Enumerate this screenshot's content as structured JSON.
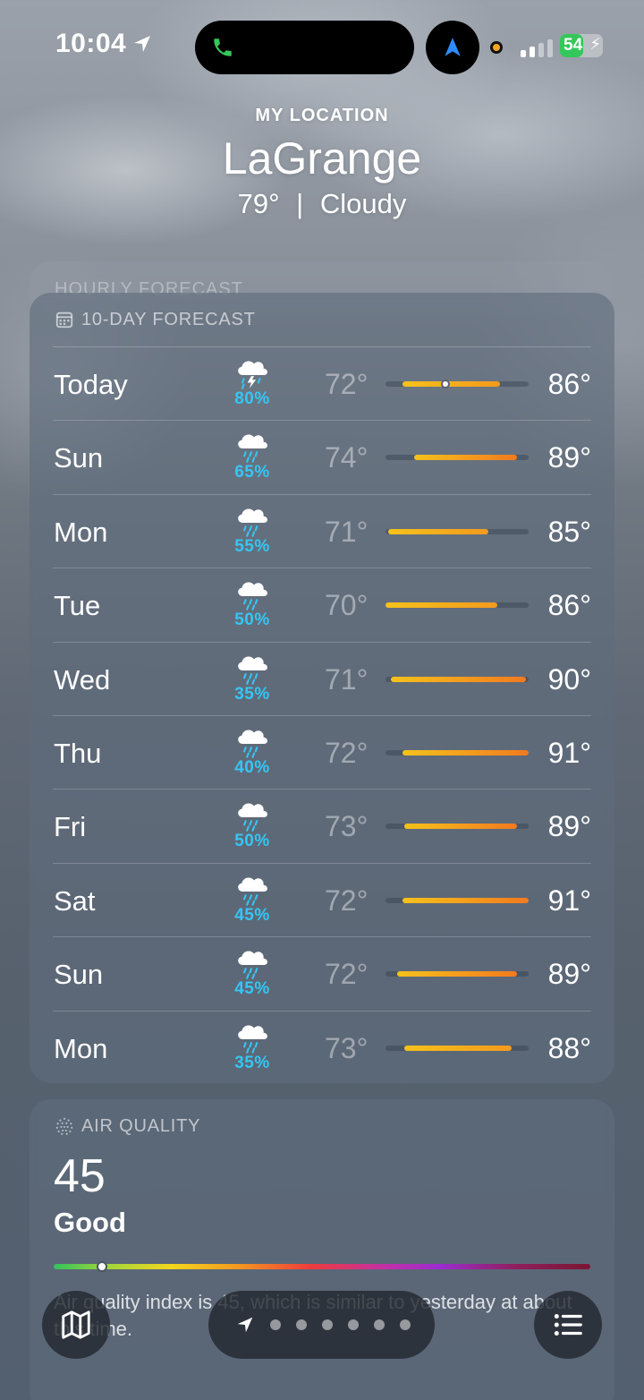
{
  "status_bar": {
    "time": "10:04",
    "battery": "54",
    "battery_level": 0.54
  },
  "header": {
    "location_label": "MY LOCATION",
    "city": "LaGrange",
    "temperature": "79°",
    "separator": "|",
    "condition": "Cloudy"
  },
  "hourly": {
    "title": "HOURLY FORECAST"
  },
  "forecast": {
    "title": "10-DAY FORECAST",
    "days": [
      {
        "day": "Today",
        "icon": "thunderstorm-rain-icon",
        "precip": "80%",
        "low": "72°",
        "high": "86°",
        "range_start": 0.12,
        "range_end": 0.8,
        "current": 0.42
      },
      {
        "day": "Sun",
        "icon": "rain-icon",
        "precip": "65%",
        "low": "74°",
        "high": "89°",
        "range_start": 0.2,
        "range_end": 0.92
      },
      {
        "day": "Mon",
        "icon": "rain-icon",
        "precip": "55%",
        "low": "71°",
        "high": "85°",
        "range_start": 0.02,
        "range_end": 0.72
      },
      {
        "day": "Tue",
        "icon": "rain-icon",
        "precip": "50%",
        "low": "70°",
        "high": "86°",
        "range_start": 0.0,
        "range_end": 0.78
      },
      {
        "day": "Wed",
        "icon": "rain-icon",
        "precip": "35%",
        "low": "71°",
        "high": "90°",
        "range_start": 0.04,
        "range_end": 0.98
      },
      {
        "day": "Thu",
        "icon": "rain-icon",
        "precip": "40%",
        "low": "72°",
        "high": "91°",
        "range_start": 0.12,
        "range_end": 1.0
      },
      {
        "day": "Fri",
        "icon": "rain-icon",
        "precip": "50%",
        "low": "73°",
        "high": "89°",
        "range_start": 0.13,
        "range_end": 0.92
      },
      {
        "day": "Sat",
        "icon": "rain-icon",
        "precip": "45%",
        "low": "72°",
        "high": "91°",
        "range_start": 0.12,
        "range_end": 1.0
      },
      {
        "day": "Sun",
        "icon": "rain-icon",
        "precip": "45%",
        "low": "72°",
        "high": "89°",
        "range_start": 0.08,
        "range_end": 0.92
      },
      {
        "day": "Mon",
        "icon": "rain-icon",
        "precip": "35%",
        "low": "73°",
        "high": "88°",
        "range_start": 0.13,
        "range_end": 0.88
      }
    ]
  },
  "air_quality": {
    "title": "AIR QUALITY",
    "value": "45",
    "category": "Good",
    "level": 0.09,
    "note": "Air quality index is 45, which is similar to yesterday at about this time."
  },
  "toolbar": {
    "page_count": 6
  },
  "colors": {
    "precip": "#35c6f4",
    "range_cool": "#f5c21b",
    "range_warm": "#f27a1f"
  }
}
